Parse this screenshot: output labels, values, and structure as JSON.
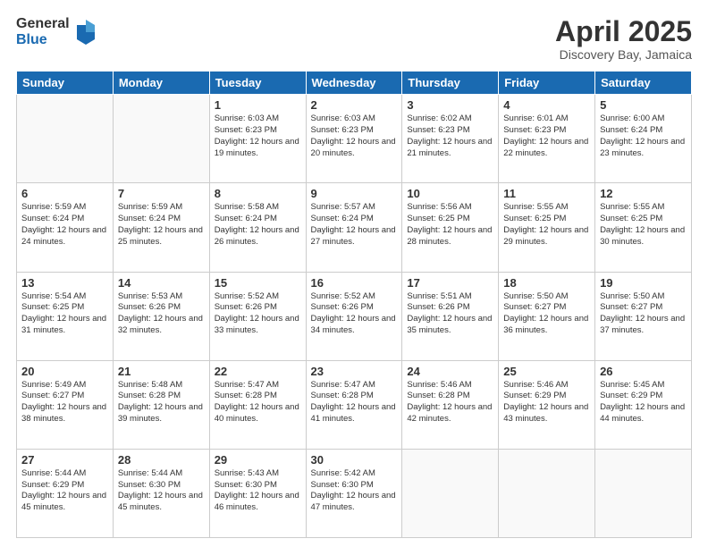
{
  "logo": {
    "general": "General",
    "blue": "Blue"
  },
  "header": {
    "title": "April 2025",
    "subtitle": "Discovery Bay, Jamaica"
  },
  "days_of_week": [
    "Sunday",
    "Monday",
    "Tuesday",
    "Wednesday",
    "Thursday",
    "Friday",
    "Saturday"
  ],
  "weeks": [
    [
      {
        "day": "",
        "info": ""
      },
      {
        "day": "",
        "info": ""
      },
      {
        "day": "1",
        "info": "Sunrise: 6:03 AM\nSunset: 6:23 PM\nDaylight: 12 hours and 19 minutes."
      },
      {
        "day": "2",
        "info": "Sunrise: 6:03 AM\nSunset: 6:23 PM\nDaylight: 12 hours and 20 minutes."
      },
      {
        "day": "3",
        "info": "Sunrise: 6:02 AM\nSunset: 6:23 PM\nDaylight: 12 hours and 21 minutes."
      },
      {
        "day": "4",
        "info": "Sunrise: 6:01 AM\nSunset: 6:23 PM\nDaylight: 12 hours and 22 minutes."
      },
      {
        "day": "5",
        "info": "Sunrise: 6:00 AM\nSunset: 6:24 PM\nDaylight: 12 hours and 23 minutes."
      }
    ],
    [
      {
        "day": "6",
        "info": "Sunrise: 5:59 AM\nSunset: 6:24 PM\nDaylight: 12 hours and 24 minutes."
      },
      {
        "day": "7",
        "info": "Sunrise: 5:59 AM\nSunset: 6:24 PM\nDaylight: 12 hours and 25 minutes."
      },
      {
        "day": "8",
        "info": "Sunrise: 5:58 AM\nSunset: 6:24 PM\nDaylight: 12 hours and 26 minutes."
      },
      {
        "day": "9",
        "info": "Sunrise: 5:57 AM\nSunset: 6:24 PM\nDaylight: 12 hours and 27 minutes."
      },
      {
        "day": "10",
        "info": "Sunrise: 5:56 AM\nSunset: 6:25 PM\nDaylight: 12 hours and 28 minutes."
      },
      {
        "day": "11",
        "info": "Sunrise: 5:55 AM\nSunset: 6:25 PM\nDaylight: 12 hours and 29 minutes."
      },
      {
        "day": "12",
        "info": "Sunrise: 5:55 AM\nSunset: 6:25 PM\nDaylight: 12 hours and 30 minutes."
      }
    ],
    [
      {
        "day": "13",
        "info": "Sunrise: 5:54 AM\nSunset: 6:25 PM\nDaylight: 12 hours and 31 minutes."
      },
      {
        "day": "14",
        "info": "Sunrise: 5:53 AM\nSunset: 6:26 PM\nDaylight: 12 hours and 32 minutes."
      },
      {
        "day": "15",
        "info": "Sunrise: 5:52 AM\nSunset: 6:26 PM\nDaylight: 12 hours and 33 minutes."
      },
      {
        "day": "16",
        "info": "Sunrise: 5:52 AM\nSunset: 6:26 PM\nDaylight: 12 hours and 34 minutes."
      },
      {
        "day": "17",
        "info": "Sunrise: 5:51 AM\nSunset: 6:26 PM\nDaylight: 12 hours and 35 minutes."
      },
      {
        "day": "18",
        "info": "Sunrise: 5:50 AM\nSunset: 6:27 PM\nDaylight: 12 hours and 36 minutes."
      },
      {
        "day": "19",
        "info": "Sunrise: 5:50 AM\nSunset: 6:27 PM\nDaylight: 12 hours and 37 minutes."
      }
    ],
    [
      {
        "day": "20",
        "info": "Sunrise: 5:49 AM\nSunset: 6:27 PM\nDaylight: 12 hours and 38 minutes."
      },
      {
        "day": "21",
        "info": "Sunrise: 5:48 AM\nSunset: 6:28 PM\nDaylight: 12 hours and 39 minutes."
      },
      {
        "day": "22",
        "info": "Sunrise: 5:47 AM\nSunset: 6:28 PM\nDaylight: 12 hours and 40 minutes."
      },
      {
        "day": "23",
        "info": "Sunrise: 5:47 AM\nSunset: 6:28 PM\nDaylight: 12 hours and 41 minutes."
      },
      {
        "day": "24",
        "info": "Sunrise: 5:46 AM\nSunset: 6:28 PM\nDaylight: 12 hours and 42 minutes."
      },
      {
        "day": "25",
        "info": "Sunrise: 5:46 AM\nSunset: 6:29 PM\nDaylight: 12 hours and 43 minutes."
      },
      {
        "day": "26",
        "info": "Sunrise: 5:45 AM\nSunset: 6:29 PM\nDaylight: 12 hours and 44 minutes."
      }
    ],
    [
      {
        "day": "27",
        "info": "Sunrise: 5:44 AM\nSunset: 6:29 PM\nDaylight: 12 hours and 45 minutes."
      },
      {
        "day": "28",
        "info": "Sunrise: 5:44 AM\nSunset: 6:30 PM\nDaylight: 12 hours and 45 minutes."
      },
      {
        "day": "29",
        "info": "Sunrise: 5:43 AM\nSunset: 6:30 PM\nDaylight: 12 hours and 46 minutes."
      },
      {
        "day": "30",
        "info": "Sunrise: 5:42 AM\nSunset: 6:30 PM\nDaylight: 12 hours and 47 minutes."
      },
      {
        "day": "",
        "info": ""
      },
      {
        "day": "",
        "info": ""
      },
      {
        "day": "",
        "info": ""
      }
    ]
  ]
}
